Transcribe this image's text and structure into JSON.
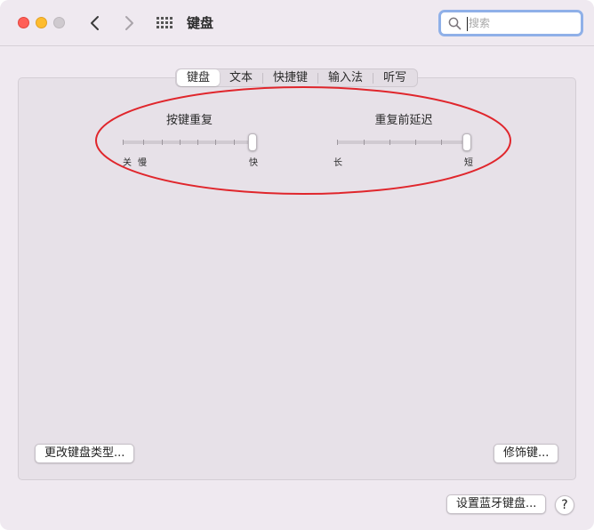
{
  "window": {
    "title": "键盘",
    "search": {
      "placeholder": "搜索",
      "value": ""
    }
  },
  "tabs": [
    {
      "label": "键盘",
      "active": true
    },
    {
      "label": "文本",
      "active": false
    },
    {
      "label": "快捷键",
      "active": false
    },
    {
      "label": "输入法",
      "active": false
    },
    {
      "label": "听写",
      "active": false
    }
  ],
  "key_repeat": {
    "title": "按键重复",
    "label_off": "关",
    "label_slow": "慢",
    "label_fast": "快",
    "level": 1.0
  },
  "repeat_delay": {
    "title": "重复前延迟",
    "label_long": "长",
    "label_short": "短",
    "level": 1.0
  },
  "buttons": {
    "change_keyboard_type": "更改键盘类型...",
    "modifier_keys": "修饰键...",
    "setup_bluetooth": "设置蓝牙键盘...",
    "help": "?"
  },
  "colors": {
    "annotation": "#e0262c",
    "search_focus": "#8fb0e8",
    "close": "#ff5f57",
    "minimize": "#febc2e",
    "zoom": "#cfcacf"
  },
  "icons": [
    "close-button",
    "minimize-button",
    "zoom-button",
    "back-chevron-icon",
    "forward-chevron-icon",
    "grid-icon",
    "search-icon",
    "help-icon"
  ]
}
